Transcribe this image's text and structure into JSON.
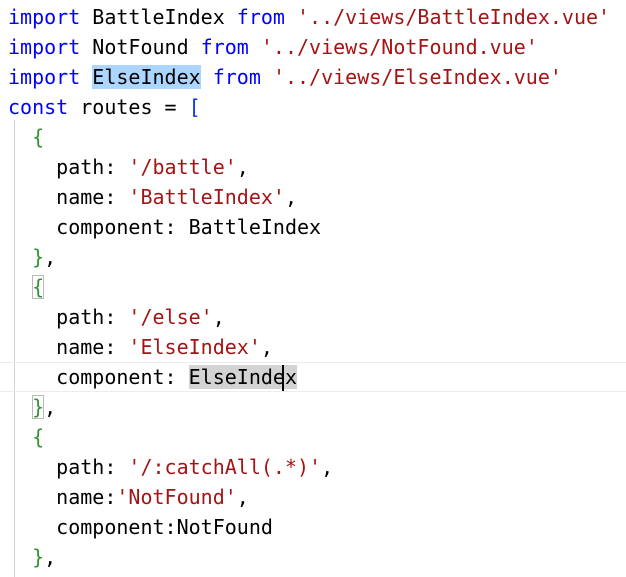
{
  "editor": {
    "lines": [
      {
        "tokens": [
          {
            "t": "import",
            "c": "kw"
          },
          {
            "t": " BattleIndex "
          },
          {
            "t": "from",
            "c": "kw"
          },
          {
            "t": " "
          },
          {
            "t": "'../views/BattleIndex.vue'",
            "c": "str"
          }
        ]
      },
      {
        "tokens": [
          {
            "t": "import",
            "c": "kw"
          },
          {
            "t": " NotFound "
          },
          {
            "t": "from",
            "c": "kw"
          },
          {
            "t": " "
          },
          {
            "t": "'../views/NotFound.vue'",
            "c": "str"
          }
        ]
      },
      {
        "tokens": [
          {
            "t": "import",
            "c": "kw"
          },
          {
            "t": " "
          },
          {
            "t": "ElseIndex",
            "c": "hl-sel"
          },
          {
            "t": " "
          },
          {
            "t": "from",
            "c": "kw"
          },
          {
            "t": " "
          },
          {
            "t": "'../views/ElseIndex.vue'",
            "c": "str"
          }
        ]
      },
      {
        "tokens": [
          {
            "t": "const",
            "c": "kw"
          },
          {
            "t": " routes = "
          },
          {
            "t": "[",
            "c": "brk"
          }
        ]
      },
      {
        "tokens": [
          {
            "t": "  "
          },
          {
            "t": "{",
            "c": "brc"
          }
        ]
      },
      {
        "tokens": [
          {
            "t": "    path: "
          },
          {
            "t": "'/battle'",
            "c": "str"
          },
          {
            "t": ","
          }
        ]
      },
      {
        "tokens": [
          {
            "t": "    name: "
          },
          {
            "t": "'BattleIndex'",
            "c": "str"
          },
          {
            "t": ","
          }
        ]
      },
      {
        "tokens": [
          {
            "t": "    component: BattleIndex"
          }
        ]
      },
      {
        "tokens": [
          {
            "t": "  "
          },
          {
            "t": "}",
            "c": "brc"
          },
          {
            "t": ","
          }
        ]
      },
      {
        "tokens": [
          {
            "t": "  "
          },
          {
            "t": "{",
            "c": "brc-match"
          }
        ]
      },
      {
        "tokens": [
          {
            "t": "    path: "
          },
          {
            "t": "'/else'",
            "c": "str"
          },
          {
            "t": ","
          }
        ]
      },
      {
        "tokens": [
          {
            "t": "    name: "
          },
          {
            "t": "'ElseIndex'",
            "c": "str"
          },
          {
            "t": ","
          }
        ]
      },
      {
        "current": true,
        "tokens": [
          {
            "t": "    component: "
          },
          {
            "t": "ElseIndex",
            "c": "hl-word"
          }
        ]
      },
      {
        "tokens": [
          {
            "t": "  "
          },
          {
            "t": "}",
            "c": "brc-match"
          },
          {
            "t": ","
          }
        ]
      },
      {
        "tokens": [
          {
            "t": "  "
          },
          {
            "t": "{",
            "c": "brc"
          }
        ]
      },
      {
        "tokens": [
          {
            "t": "    path: "
          },
          {
            "t": "'/:catchAll(.*)'",
            "c": "str"
          },
          {
            "t": ","
          }
        ]
      },
      {
        "tokens": [
          {
            "t": "    name:"
          },
          {
            "t": "'NotFound'",
            "c": "str"
          },
          {
            "t": ","
          }
        ]
      },
      {
        "tokens": [
          {
            "t": "    component:NotFound"
          }
        ]
      },
      {
        "tokens": [
          {
            "t": "  "
          },
          {
            "t": "}",
            "c": "brc"
          },
          {
            "t": ","
          }
        ]
      }
    ]
  },
  "colors": {
    "keyword": "#0000ff",
    "string": "#a31515",
    "bracket_square": "#0431fa",
    "bracket_curly": "#319331",
    "selection_highlight": "#add6ff",
    "word_highlight": "#d3d3d3",
    "background": "#ffffff"
  }
}
